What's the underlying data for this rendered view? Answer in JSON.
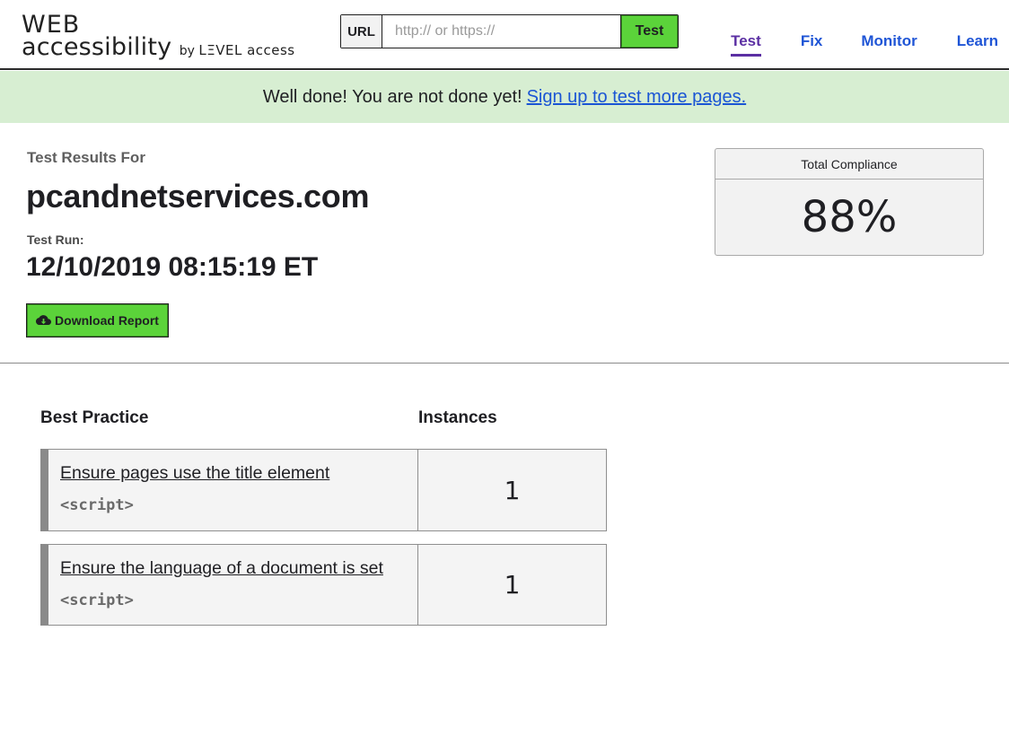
{
  "logo": {
    "word1": "WEB",
    "word2": "accessibility",
    "by": "by",
    "brand": "LΞVEL access"
  },
  "search": {
    "label": "URL",
    "placeholder": "http:// or https://",
    "value": "",
    "button_label": "Test"
  },
  "nav": {
    "items": [
      {
        "label": "Test",
        "active": true
      },
      {
        "label": "Fix",
        "active": false
      },
      {
        "label": "Monitor",
        "active": false
      },
      {
        "label": "Learn",
        "active": false
      }
    ]
  },
  "banner": {
    "text": "Well done! You are not done yet!",
    "link": "Sign up to test more pages."
  },
  "results": {
    "heading": "Test Results For",
    "domain": "pcandnetservices.com",
    "run_label": "Test Run:",
    "run_date": "12/10/2019 08:15:19 ET",
    "download_label": "Download Report"
  },
  "compliance": {
    "label": "Total Compliance",
    "value": "88%"
  },
  "table": {
    "headers": [
      "Best Practice",
      "Instances"
    ],
    "rows": [
      {
        "practice": "Ensure pages use the title element",
        "element": "<script>",
        "instances": "1"
      },
      {
        "practice": "Ensure the language of a document is set",
        "element": "<script>",
        "instances": "1"
      }
    ]
  },
  "colors": {
    "accent_green": "#5bd33a",
    "banner_bg": "#d7eed2",
    "link_blue": "#1f55d6",
    "active_purple": "#5b2fa3"
  },
  "icons": {
    "download": "cloud-download-icon"
  }
}
